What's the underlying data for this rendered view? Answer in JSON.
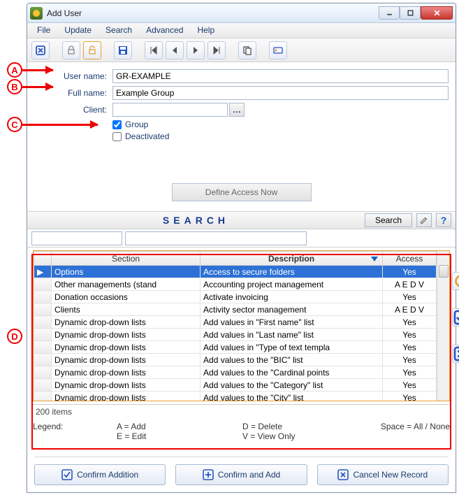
{
  "window": {
    "title": "Add User"
  },
  "menu": {
    "items": [
      "File",
      "Update",
      "Search",
      "Advanced",
      "Help"
    ]
  },
  "form": {
    "username_label": "User name:",
    "username_value": "GR-EXAMPLE",
    "fullname_label": "Full name:",
    "fullname_value": "Example Group",
    "client_label": "Client:",
    "client_value": "",
    "group_label": "Group",
    "group_checked": true,
    "deactivated_label": "Deactivated",
    "deactivated_checked": false,
    "define_access_label": "Define Access Now"
  },
  "search": {
    "heading": "SEARCH",
    "button_label": "Search"
  },
  "grid": {
    "columns": [
      "Section",
      "Description",
      "Access"
    ],
    "sorted_col": 1,
    "rows": [
      {
        "section": "Options",
        "description": "Access to secure folders",
        "access": "Yes",
        "selected": true
      },
      {
        "section": "Other managements (stand",
        "description": "Accounting project management",
        "access": "A E D V"
      },
      {
        "section": "Donation occasions",
        "description": "Activate invoicing",
        "access": "Yes"
      },
      {
        "section": "Clients",
        "description": "Activity sector management",
        "access": "A E D V"
      },
      {
        "section": "Dynamic drop-down lists",
        "description": "Add values in \"First name\" list",
        "access": "Yes"
      },
      {
        "section": "Dynamic drop-down lists",
        "description": "Add values in \"Last name\" list",
        "access": "Yes"
      },
      {
        "section": "Dynamic drop-down lists",
        "description": "Add values in \"Type of text templa",
        "access": "Yes"
      },
      {
        "section": "Dynamic drop-down lists",
        "description": "Add values to the \"BIC\" list",
        "access": "Yes"
      },
      {
        "section": "Dynamic drop-down lists",
        "description": "Add values to the \"Cardinal points",
        "access": "Yes"
      },
      {
        "section": "Dynamic drop-down lists",
        "description": "Add values to the \"Category\" list",
        "access": "Yes"
      },
      {
        "section": "Dynamic drop-down lists",
        "description": "Add values to the \"City\" list",
        "access": "Yes"
      }
    ],
    "status": "200 items"
  },
  "legend": {
    "label": "Legend:",
    "a": "A = Add",
    "e": "E = Edit",
    "d": "D = Delete",
    "v": "V = View Only",
    "space": "Space = All / None"
  },
  "buttons": {
    "confirm": "Confirm Addition",
    "confirm_add": "Confirm and Add",
    "cancel": "Cancel New Record"
  },
  "markers": {
    "a": "A",
    "b": "B",
    "c": "C",
    "d": "D"
  }
}
